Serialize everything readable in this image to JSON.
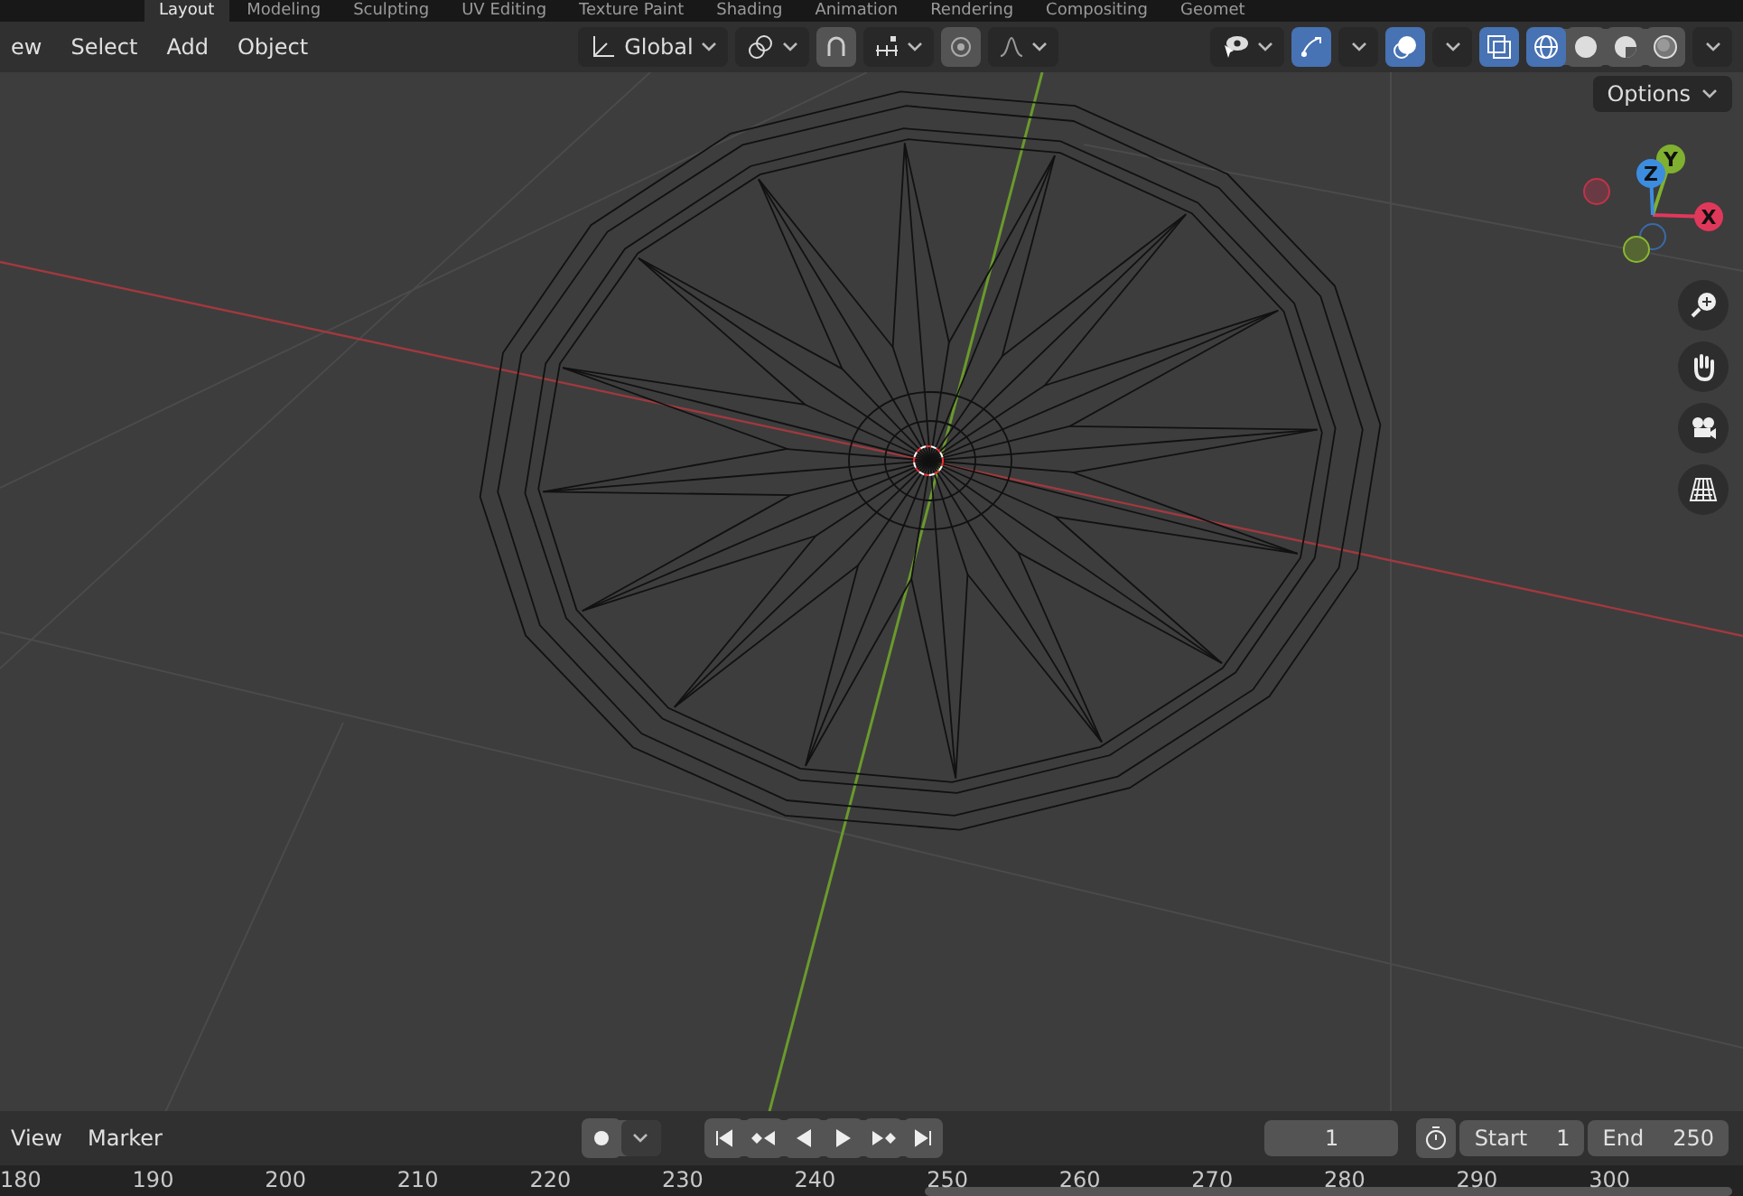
{
  "workspace_tabs": [
    {
      "label": "Layout",
      "selected": true
    },
    {
      "label": "Modeling",
      "selected": false
    },
    {
      "label": "Sculpting",
      "selected": false
    },
    {
      "label": "UV Editing",
      "selected": false
    },
    {
      "label": "Texture Paint",
      "selected": false
    },
    {
      "label": "Shading",
      "selected": false
    },
    {
      "label": "Animation",
      "selected": false
    },
    {
      "label": "Rendering",
      "selected": false
    },
    {
      "label": "Compositing",
      "selected": false
    },
    {
      "label": "Geomet",
      "selected": false
    }
  ],
  "header": {
    "menus": [
      "ew",
      "Select",
      "Add",
      "Object"
    ],
    "orientation": "Global",
    "snapping_on": false,
    "proportional_on": false,
    "gizmos_on": true,
    "overlays_on": true,
    "xray_on": true,
    "shading": [
      {
        "kind": "wireframe",
        "selected": true
      },
      {
        "kind": "solid",
        "selected": false
      },
      {
        "kind": "material",
        "selected": false
      },
      {
        "kind": "rendered",
        "selected": false
      }
    ],
    "options": "Options"
  },
  "gizmo": {
    "axes": [
      {
        "label": "X",
        "color": "#e0385a"
      },
      {
        "label": "Y",
        "color": "#80b030"
      },
      {
        "label": "Z",
        "color": "#3c8de0"
      }
    ]
  },
  "timeline": {
    "menus": [
      "View",
      "Marker"
    ],
    "auto_key_on": false,
    "current_frame": "1",
    "start_label": "Start",
    "start": "1",
    "end_label": "End",
    "end": "250",
    "ruler": [
      "180",
      "190",
      "200",
      "210",
      "220",
      "230",
      "240",
      "250",
      "260",
      "270",
      "280",
      "290",
      "300"
    ]
  }
}
